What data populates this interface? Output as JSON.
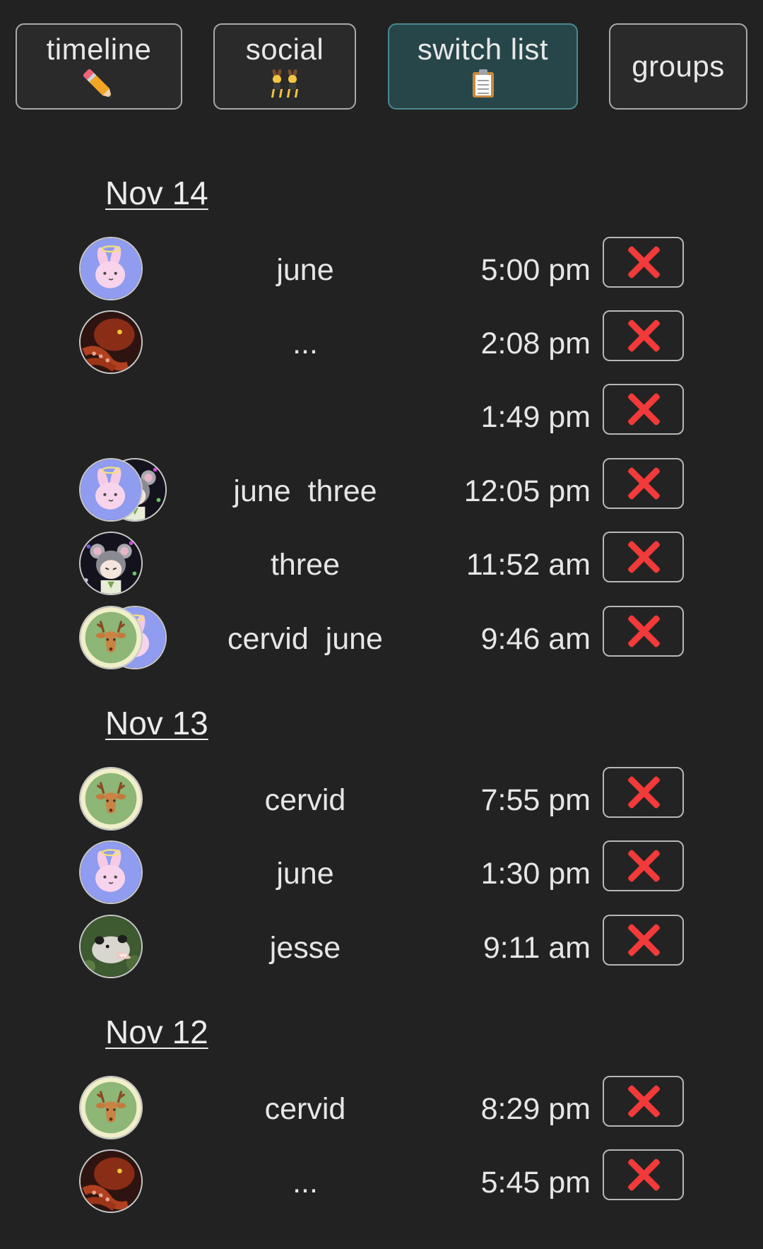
{
  "tabs": [
    {
      "label": "timeline",
      "icon": "pencil-icon",
      "active": false
    },
    {
      "label": "social",
      "icon": "dancers-icon",
      "active": false
    },
    {
      "label": "switch list",
      "icon": "clipboard-icon",
      "active": true
    },
    {
      "label": "groups",
      "icon": "",
      "active": false
    }
  ],
  "days": [
    {
      "date": "Nov 14",
      "switches": [
        {
          "names": "june",
          "time": "5:00 pm",
          "avatars": [
            "bunny-halo-avatar"
          ]
        },
        {
          "names": "...",
          "time": "2:08 pm",
          "avatars": [
            "octopus-avatar"
          ]
        },
        {
          "names": "",
          "time": "1:49 pm",
          "avatars": []
        },
        {
          "names": "june  three",
          "time": "12:05 pm",
          "avatars": [
            "bunny-halo-avatar",
            "mouse-girl-avatar"
          ]
        },
        {
          "names": "three",
          "time": "11:52 am",
          "avatars": [
            "mouse-girl-avatar"
          ]
        },
        {
          "names": "cervid  june",
          "time": "9:46 am",
          "avatars": [
            "deer-avatar",
            "bunny-halo-avatar"
          ]
        }
      ]
    },
    {
      "date": "Nov 13",
      "switches": [
        {
          "names": "cervid",
          "time": "7:55 pm",
          "avatars": [
            "deer-avatar"
          ]
        },
        {
          "names": "june",
          "time": "1:30 pm",
          "avatars": [
            "bunny-halo-avatar"
          ]
        },
        {
          "names": "jesse",
          "time": "9:11 am",
          "avatars": [
            "opossum-avatar"
          ]
        }
      ]
    },
    {
      "date": "Nov 12",
      "switches": [
        {
          "names": "cervid",
          "time": "8:29 pm",
          "avatars": [
            "deer-avatar"
          ]
        },
        {
          "names": "...",
          "time": "5:45 pm",
          "avatars": [
            "octopus-avatar"
          ]
        }
      ]
    }
  ],
  "delete_icon": "red-x-icon",
  "colors": {
    "background": "#222222",
    "active_tab": "#27464a",
    "delete_x": "#f23a3a"
  }
}
